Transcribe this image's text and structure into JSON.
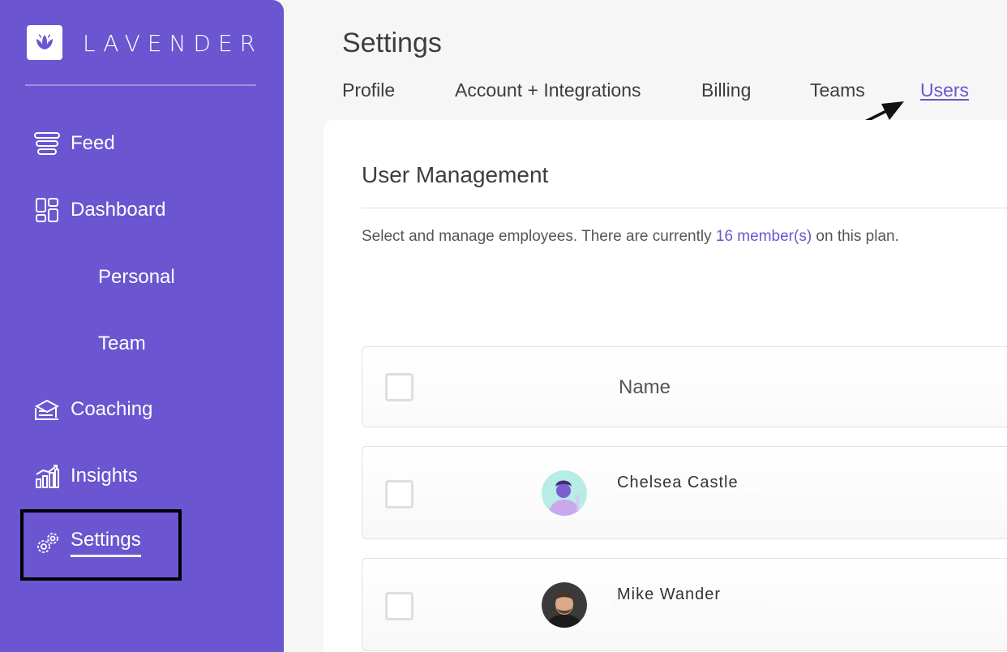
{
  "brand": {
    "name": "LAVENDER",
    "accent": "#6b55d1"
  },
  "sidebar": {
    "items": [
      {
        "label": "Feed",
        "icon": "feed-icon"
      },
      {
        "label": "Dashboard",
        "icon": "dashboard-icon"
      },
      {
        "label": "Personal"
      },
      {
        "label": "Team"
      },
      {
        "label": "Coaching",
        "icon": "coaching-icon"
      },
      {
        "label": "Insights",
        "icon": "insights-icon"
      },
      {
        "label": "Settings",
        "icon": "gears-icon",
        "active": true
      }
    ]
  },
  "page": {
    "title": "Settings"
  },
  "tabs": [
    {
      "label": "Profile"
    },
    {
      "label": "Account + Integrations"
    },
    {
      "label": "Billing"
    },
    {
      "label": "Teams"
    },
    {
      "label": "Users",
      "active": true
    }
  ],
  "user_management": {
    "title": "User Management",
    "description_prefix": "Select and manage employees. There are currently ",
    "member_count": "16 member(s)",
    "description_suffix": " on this plan.",
    "table": {
      "columns": [
        "Name"
      ],
      "rows": [
        {
          "name": "Chelsea Castle",
          "avatar": "illustrated-avatar"
        },
        {
          "name": "Mike Wander",
          "avatar": "photo-avatar"
        }
      ]
    }
  }
}
